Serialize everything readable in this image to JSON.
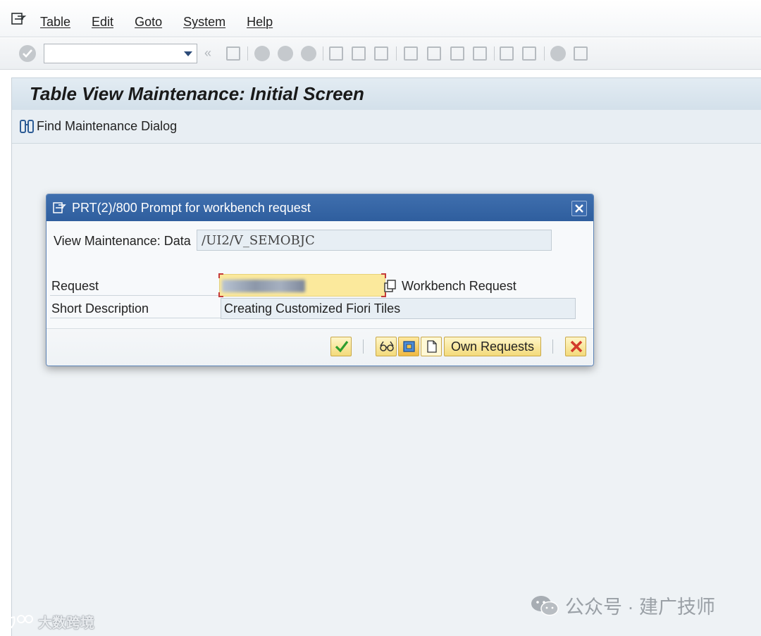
{
  "menubar": {
    "items": [
      "Table",
      "Edit",
      "Goto",
      "System",
      "Help"
    ]
  },
  "toolbar": {
    "command_field_value": "",
    "icons": [
      "enter-icon",
      "command-dropdown-icon",
      "back-double-chevron-icon",
      "save-icon",
      "back-icon",
      "exit-icon",
      "cancel-icon",
      "print-icon",
      "find-icon",
      "find-next-icon",
      "first-page-icon",
      "previous-page-icon",
      "next-page-icon",
      "last-page-icon",
      "create-session-icon",
      "shortcut-icon",
      "help-icon",
      "layout-icon"
    ]
  },
  "screen": {
    "title": "Table View Maintenance: Initial Screen",
    "find_dialog_label": "Find Maintenance Dialog"
  },
  "dialog": {
    "title": "PRT(2)/800 Prompt for workbench request",
    "view_label": "View Maintenance: Data",
    "view_value": "/UI2/V_SEMOBJC",
    "request_label": "Request",
    "request_type": "Workbench Request",
    "short_desc_label": "Short Description",
    "short_desc_value": "Creating Customized Fiori Tiles",
    "own_requests_label": "Own Requests"
  },
  "watermark": {
    "right_text": "公众号 · 建广技师",
    "left_text": "大数跨境"
  },
  "colors": {
    "dialog_header": "#2f5e9e",
    "request_field_bg": "#fbe99c",
    "confirm_green": "#2e9e2e",
    "cancel_red": "#d23a2a"
  }
}
